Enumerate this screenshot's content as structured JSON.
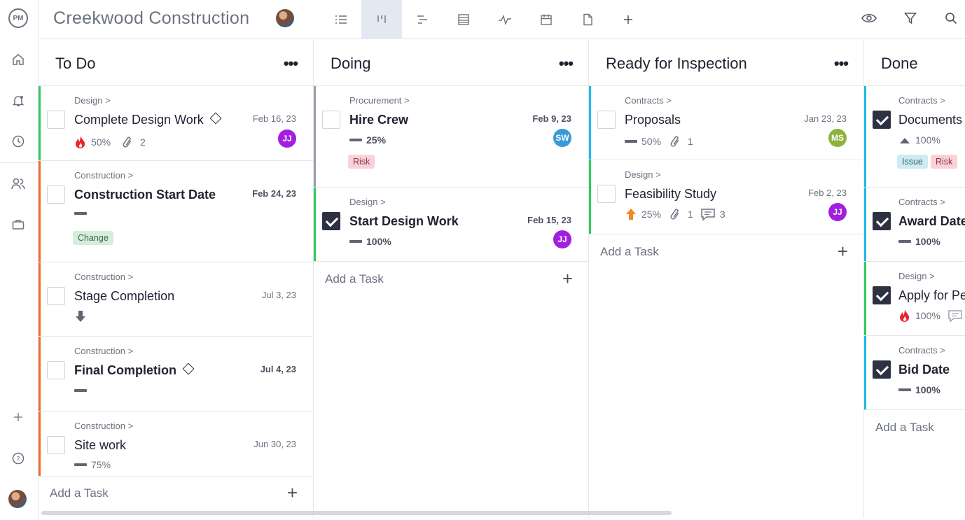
{
  "rail": {
    "logo": "PM",
    "icons": [
      "home-icon",
      "notifications-icon",
      "clock-icon",
      "people-icon",
      "briefcase-icon",
      "plus-icon",
      "help-icon"
    ]
  },
  "header": {
    "project_title": "Creekwood Construction",
    "view_icons": [
      "list-view-icon",
      "board-view-icon",
      "gantt-view-icon",
      "sheet-view-icon",
      "dashboard-view-icon",
      "calendar-view-icon",
      "files-view-icon",
      "add-view-icon"
    ],
    "active_view": "board-view-icon",
    "right_icons": [
      "eye-icon",
      "filter-icon",
      "search-icon"
    ]
  },
  "colors": {
    "green": "#2ecc5a",
    "orange": "#f26a21",
    "gray": "#9aa1ad",
    "cyan": "#1fb8e8",
    "purple_avatar": "#a21fe0",
    "blue_avatar": "#3a9ad9",
    "olive_avatar": "#8db33a"
  },
  "columns": [
    {
      "title": "To Do",
      "menu": "•••",
      "add_task": "Add a Task",
      "cards": [
        {
          "crumb": "Design >",
          "name": "Complete Design Work",
          "milestone": true,
          "date": "Feb 16, 23",
          "progress": "50%",
          "priority": "fire-icon",
          "attachments": "2",
          "avatar": "JJ",
          "bold": false
        },
        {
          "crumb": "Construction >",
          "name": "Construction Start Date",
          "date": "Feb 24, 23",
          "priority": "dash",
          "tag": "Change",
          "bold": true
        },
        {
          "crumb": "Construction >",
          "name": "Stage Completion",
          "date": "Jul 3, 23",
          "priority": "arrow-down-icon",
          "bold": false
        },
        {
          "crumb": "Construction >",
          "name": "Final Completion",
          "milestone": true,
          "date": "Jul 4, 23",
          "priority": "dash",
          "bold": true
        },
        {
          "crumb": "Construction >",
          "name": "Site work",
          "date": "Jun 30, 23",
          "priority": "dash",
          "progress": "75%",
          "bold": false
        }
      ]
    },
    {
      "title": "Doing",
      "menu": "•••",
      "add_task": "Add a Task",
      "cards": [
        {
          "crumb": "Procurement >",
          "name": "Hire Crew",
          "date": "Feb 9, 23",
          "priority": "dash",
          "progress": "25%",
          "tag": "Risk",
          "avatar": "SW",
          "bold": true
        },
        {
          "crumb": "Design >",
          "name": "Start Design Work",
          "date": "Feb 15, 23",
          "priority": "dash",
          "progress": "100%",
          "avatar": "JJ",
          "checked": true,
          "bold": true
        }
      ]
    },
    {
      "title": "Ready for Inspection",
      "menu": "•••",
      "add_task": "Add a Task",
      "cards": [
        {
          "crumb": "Contracts >",
          "name": "Proposals",
          "date": "Jan 23, 23",
          "priority": "dash",
          "progress": "50%",
          "attachments": "1",
          "avatar": "MS",
          "bold": false
        },
        {
          "crumb": "Design >",
          "name": "Feasibility Study",
          "date": "Feb 2, 23",
          "priority": "arrow-up-icon",
          "progress": "25%",
          "attachments": "1",
          "comments": "3",
          "avatar": "JJ",
          "bold": false
        }
      ]
    },
    {
      "title": "Done",
      "add_task": "Add a Task",
      "cards": [
        {
          "crumb": "Contracts >",
          "name": "Documents",
          "priority": "triangle-up-icon",
          "progress": "100%",
          "tags": [
            "Issue",
            "Risk"
          ],
          "checked": true,
          "bold": false
        },
        {
          "crumb": "Contracts >",
          "name": "Award Date",
          "priority": "dash",
          "progress": "100%",
          "checked": true,
          "bold": true
        },
        {
          "crumb": "Design >",
          "name": "Apply for Pe",
          "priority": "fire-icon",
          "progress": "100%",
          "checked": true,
          "bold": false
        },
        {
          "crumb": "Contracts >",
          "name": "Bid Date",
          "priority": "dash",
          "progress": "100%",
          "checked": true,
          "bold": true
        }
      ]
    }
  ]
}
